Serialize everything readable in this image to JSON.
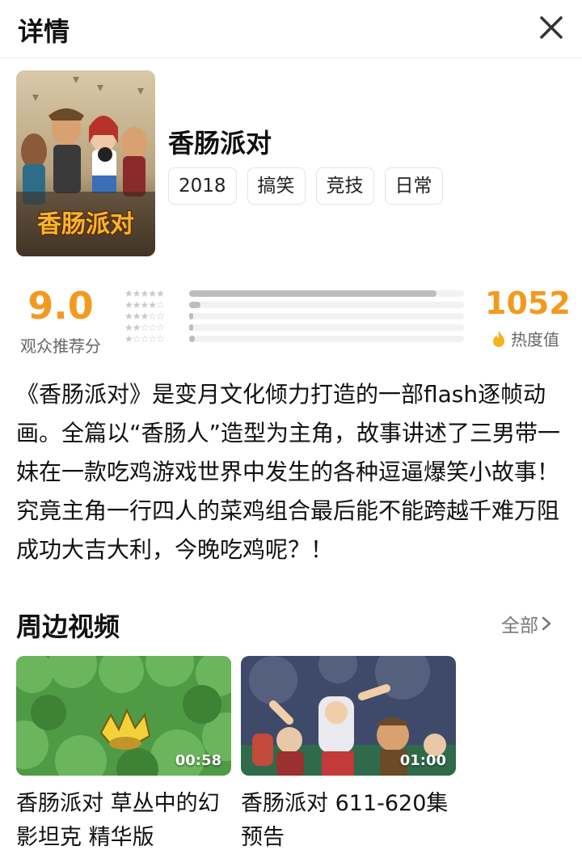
{
  "header": {
    "title": "详情"
  },
  "show": {
    "title": "香肠派对",
    "poster_logo_text": "香肠派对",
    "tags": [
      "2018",
      "搞笑",
      "竞技",
      "日常"
    ]
  },
  "rating": {
    "score": "9.0",
    "score_label": "观众推荐分",
    "distribution": [
      0.9,
      0.04,
      0.01,
      0.01,
      0.02
    ],
    "heat": "1052",
    "heat_label": "热度值"
  },
  "description": "《香肠派对》是变月文化倾力打造的一部flash逐帧动画。全篇以“香肠人”造型为主角，故事讲述了三男带一妹在一款吃鸡游戏世界中发生的各种逗逼爆笑小故事！究竟主角一行四人的菜鸡组合最后能不能跨越千难万阻成功大吉大利，今晚吃鸡呢？！",
  "related": {
    "title": "周边视频",
    "see_all": "全部",
    "videos": [
      {
        "title": "香肠派对 草丛中的幻影坦克 精华版",
        "duration": "00:58"
      },
      {
        "title": "香肠派对 611-620集预告",
        "duration": "01:00"
      }
    ]
  },
  "colors": {
    "accent": "#f39a1e"
  }
}
